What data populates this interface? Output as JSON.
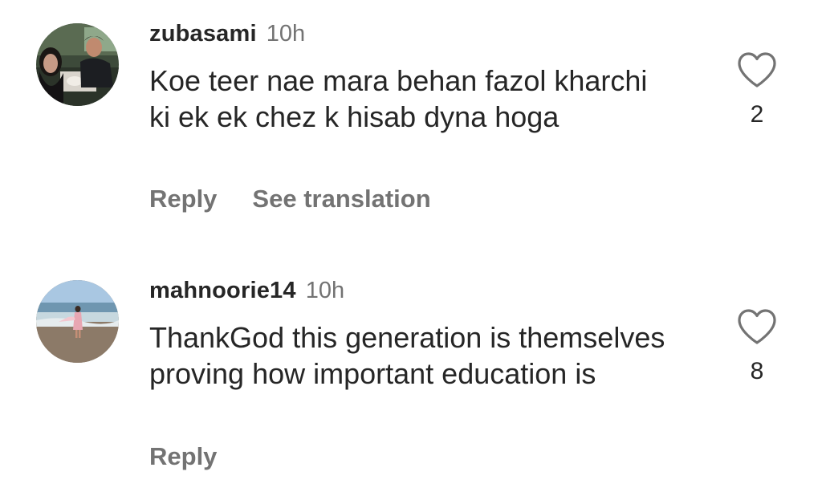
{
  "comments": [
    {
      "username": "zubasami",
      "time": "10h",
      "text": "Koe teer nae mara behan fazol kharchi ki ek ek chez k hisab dyna hoga",
      "likes": "2",
      "reply_label": "Reply",
      "translate_label": "See translation",
      "avatar_icon": "avatar-couple-photo"
    },
    {
      "username": "mahnoorie14",
      "time": "10h",
      "text": "ThankGod this generation is themselves proving how important education is",
      "likes": "8",
      "reply_label": "Reply",
      "avatar_icon": "avatar-beach-photo"
    }
  ],
  "colors": {
    "primary_text": "#262626",
    "secondary_text": "#737373",
    "background": "#ffffff"
  }
}
